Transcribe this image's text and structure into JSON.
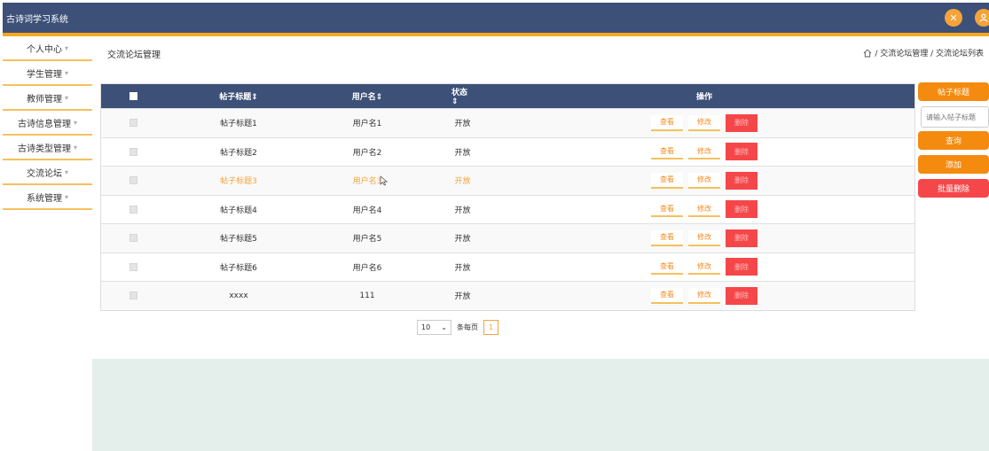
{
  "app": {
    "title": "古诗词学习系统"
  },
  "sidebar": {
    "items": [
      {
        "label": "个人中心"
      },
      {
        "label": "学生管理"
      },
      {
        "label": "教师管理"
      },
      {
        "label": "古诗信息管理"
      },
      {
        "label": "古诗类型管理"
      },
      {
        "label": "交流论坛"
      },
      {
        "label": "系统管理"
      }
    ],
    "caret": "▾"
  },
  "page": {
    "heading": "交流论坛管理",
    "breadcrumb": "/ 交流论坛管理 / 交流论坛列表"
  },
  "table": {
    "columns": {
      "title": "帖子标题⇕",
      "user": "用户名⇕",
      "status": "状态⇕",
      "ops": "操作"
    },
    "rows": [
      {
        "title": "帖子标题1",
        "user": "用户名1",
        "status": "开放"
      },
      {
        "title": "帖子标题2",
        "user": "用户名2",
        "status": "开放"
      },
      {
        "title": "帖子标题3",
        "user": "用户名3",
        "status": "开放"
      },
      {
        "title": "帖子标题4",
        "user": "用户名4",
        "status": "开放"
      },
      {
        "title": "帖子标题5",
        "user": "用户名5",
        "status": "开放"
      },
      {
        "title": "帖子标题6",
        "user": "用户名6",
        "status": "开放"
      },
      {
        "title": "xxxx",
        "user": "111",
        "status": "开放"
      }
    ],
    "actions": {
      "view": "查看",
      "edit": "修改",
      "delete": "删除"
    }
  },
  "pager": {
    "page_size": "10",
    "per_page_label": "条每页",
    "current_page": "1"
  },
  "right_panel": {
    "search_label": "帖子标题",
    "search_placeholder": "请输入帖子标题",
    "query": "查询",
    "add": "添加",
    "batch_delete": "批量删除"
  },
  "colors": {
    "header": "#3d5078",
    "accent": "#f4a920",
    "orange": "#f48a0e",
    "danger": "#f5474a",
    "footer": "#e4efeb"
  }
}
